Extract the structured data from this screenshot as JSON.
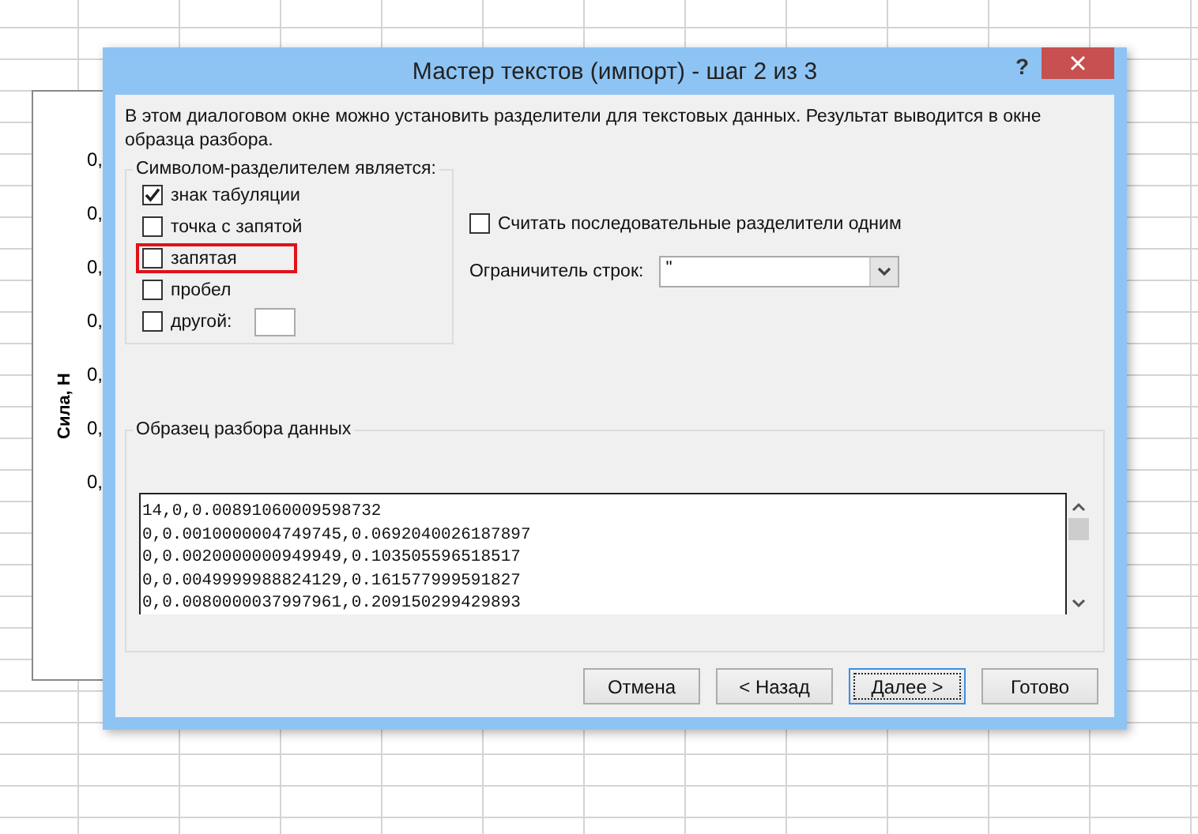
{
  "spreadsheet": {
    "chart": {
      "axis_title": "Сила, Н",
      "tick_labels": [
        "0,",
        "0,",
        "0,",
        "0,",
        "0,",
        "0,",
        "0,"
      ]
    }
  },
  "dialog": {
    "title": "Мастер текстов (импорт) - шаг 2 из 3",
    "help_button": "?",
    "description": "В этом диалоговом окне можно установить разделители для текстовых данных. Результат выводится в окне образца разбора.",
    "delimiters": {
      "legend": "Символом-разделителем является:",
      "options": [
        {
          "kind": "checkbox",
          "label": "знак табуляции",
          "checked": true,
          "highlighted": false
        },
        {
          "kind": "checkbox",
          "label": "точка с запятой",
          "checked": false,
          "highlighted": false
        },
        {
          "kind": "checkbox",
          "label": "запятая",
          "checked": false,
          "highlighted": true
        },
        {
          "kind": "checkbox",
          "label": "пробел",
          "checked": false,
          "highlighted": false
        },
        {
          "kind": "with_field",
          "label": "другой:",
          "checked": false,
          "highlighted": false
        }
      ]
    },
    "treat_consecutive": {
      "label": "Считать последовательные разделители одним",
      "checked": false
    },
    "text_qualifier": {
      "label": "Ограничитель строк:",
      "value": "\""
    },
    "preview": {
      "legend": "Образец разбора данных",
      "lines": [
        "14,0,0.00891060009598732",
        "0,0.0010000004749745,0.0692040026187897",
        "0,0.0020000000949949,0.103505596518517",
        "0,0.0049999988824129,0.161577999591827",
        "0,0.0080000037997961,0.209150299429893"
      ]
    },
    "buttons": [
      {
        "label": "Отмена",
        "default": false
      },
      {
        "label": "< Назад",
        "default": false
      },
      {
        "label": "Далее >",
        "default": true
      },
      {
        "label": "Готово",
        "default": false
      }
    ]
  }
}
